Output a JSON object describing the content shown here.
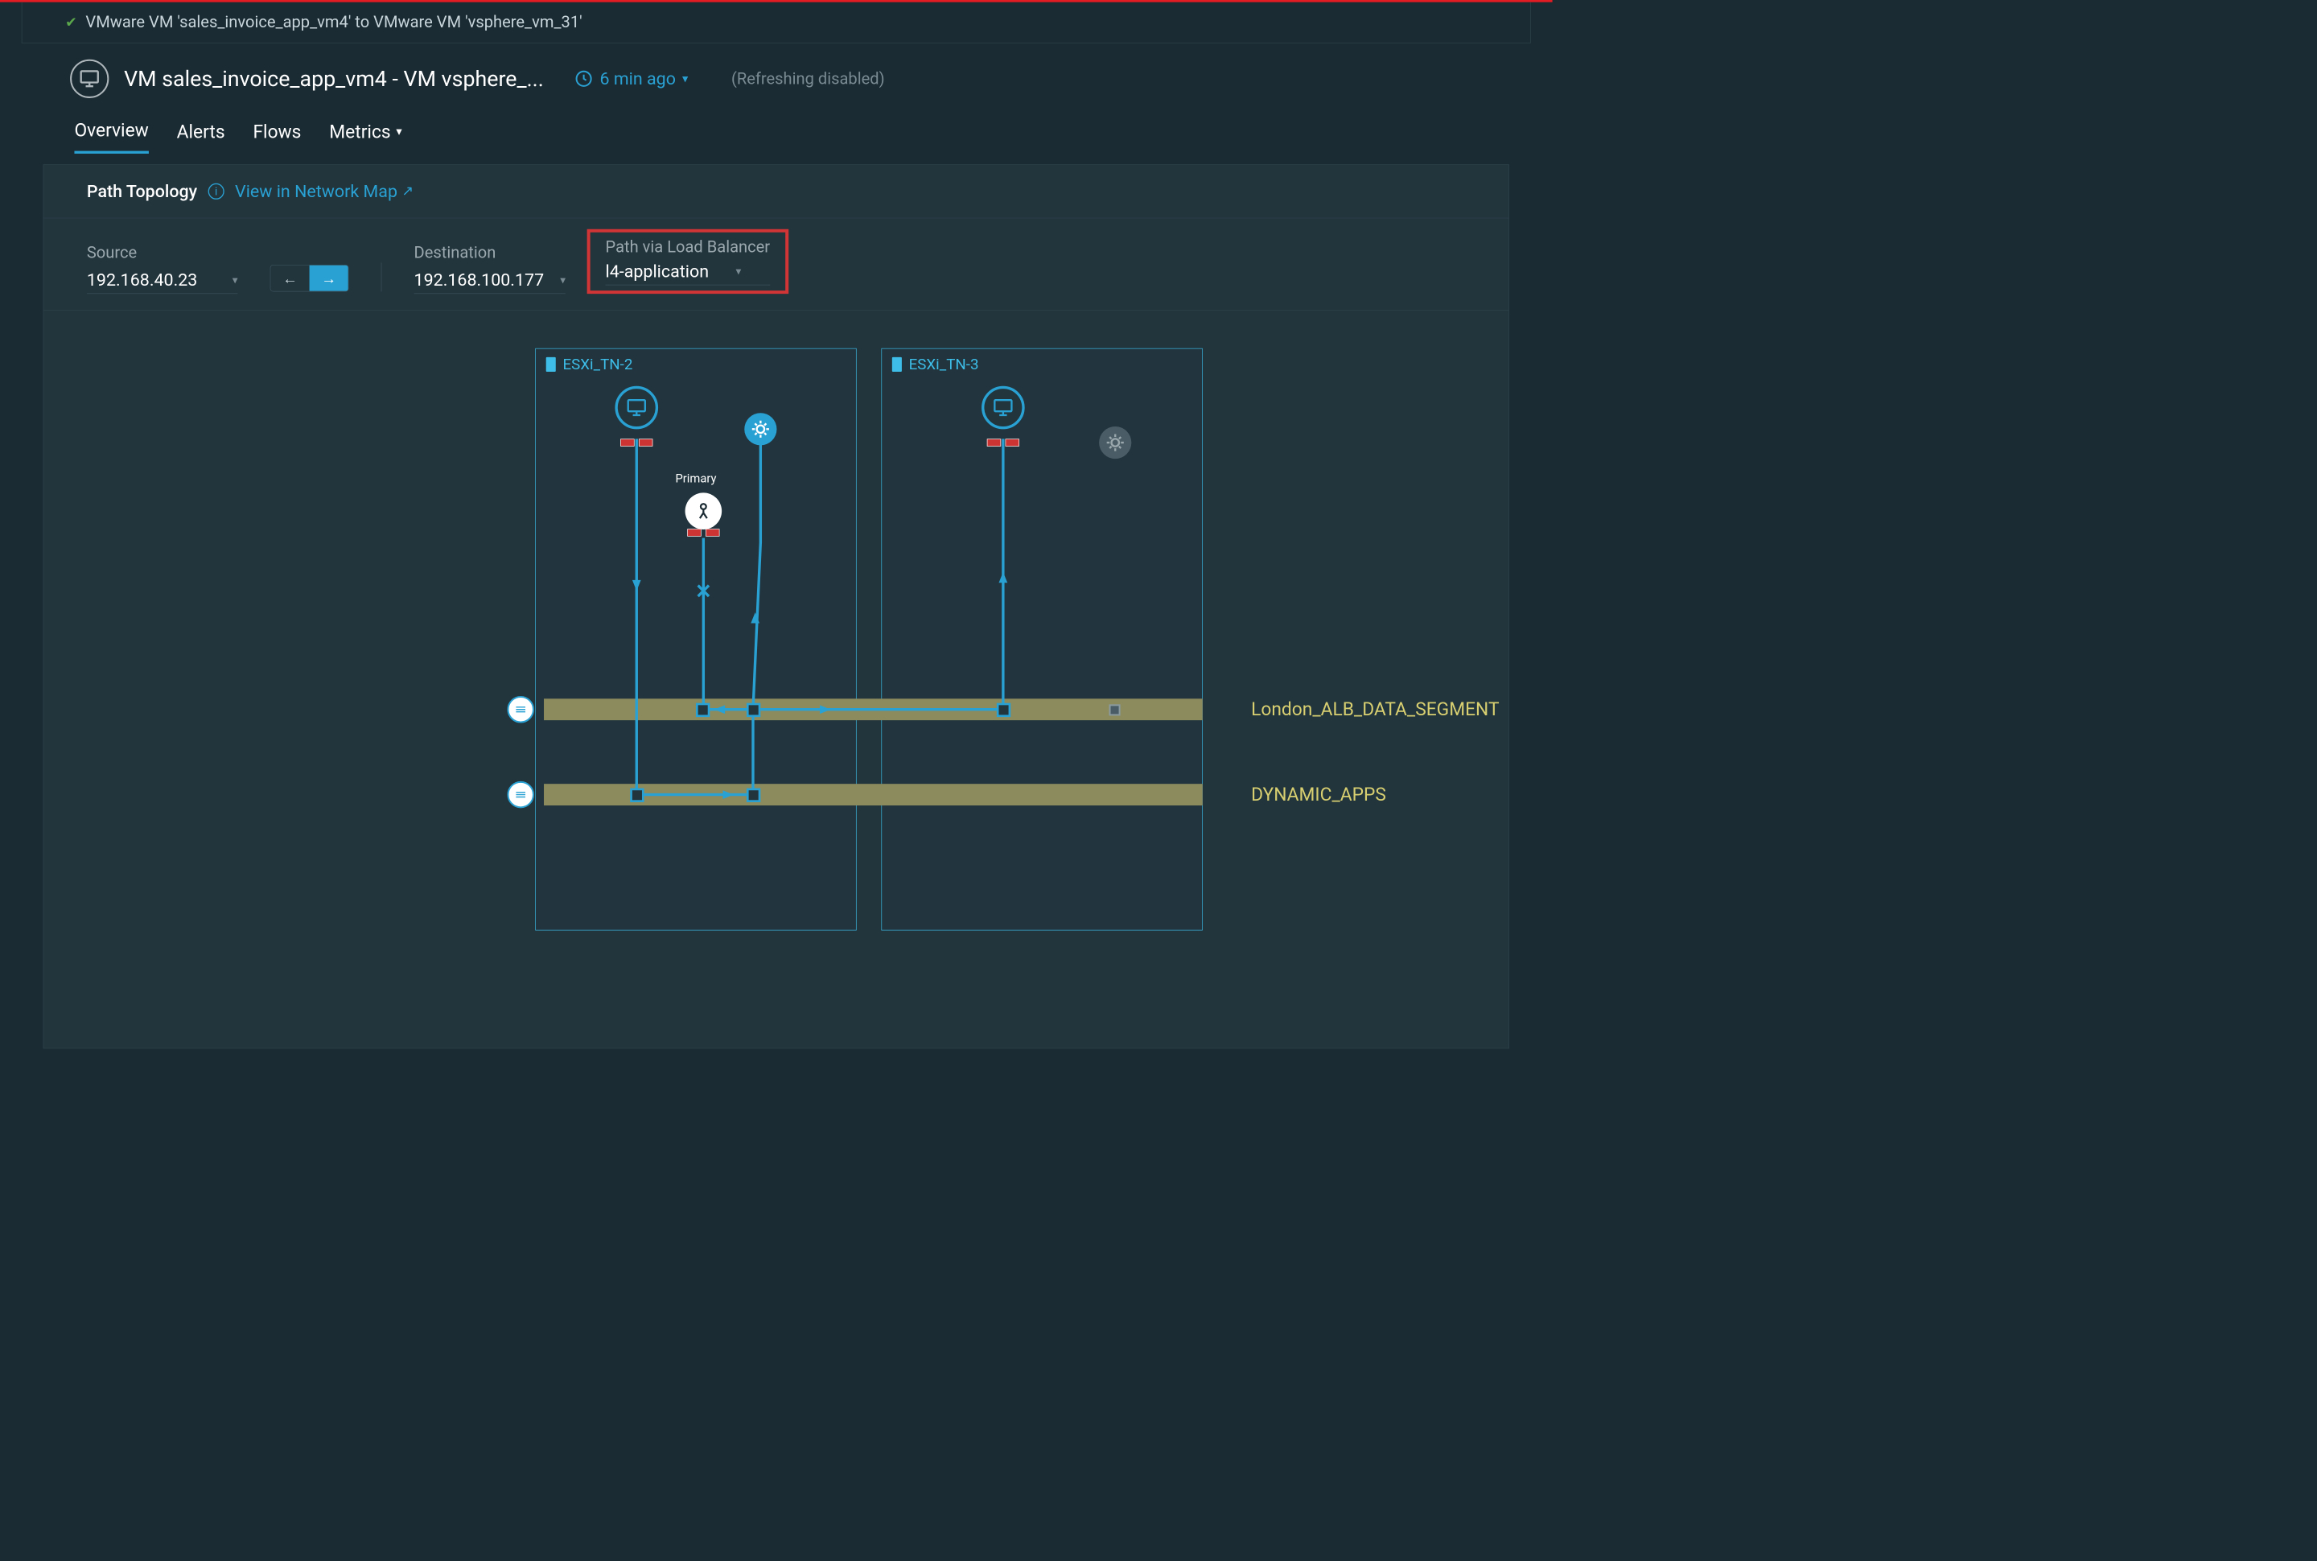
{
  "breadcrumb": "VMware VM 'sales_invoice_app_vm4' to VMware VM 'vsphere_vm_31'",
  "title": "VM sales_invoice_app_vm4 - VM vsphere_...",
  "time_ago": "6 min ago",
  "refresh_status": "(Refreshing  disabled)",
  "tabs": [
    "Overview",
    "Alerts",
    "Flows",
    "Metrics"
  ],
  "panel": {
    "title": "Path Topology",
    "link": "View in Network Map"
  },
  "controls": {
    "source": {
      "label": "Source",
      "value": "192.168.40.23"
    },
    "destination": {
      "label": "Destination",
      "value": "192.168.100.177"
    },
    "load_balancer": {
      "label": "Path via Load Balancer",
      "value": "l4-application"
    }
  },
  "topology": {
    "hosts": [
      "ESXi_TN-2",
      "ESXi_TN-3"
    ],
    "primary_label": "Primary",
    "segments": [
      {
        "name": "London_ALB_DATA_SEGMENT"
      },
      {
        "name": "DYNAMIC_APPS"
      }
    ]
  }
}
